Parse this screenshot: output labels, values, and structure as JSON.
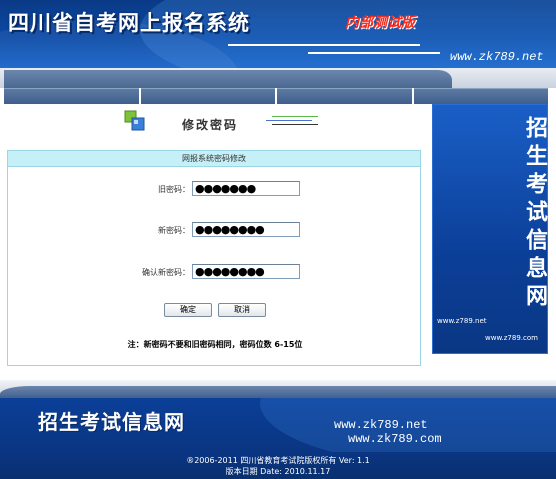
{
  "header": {
    "title": "四川省自考网上报名系统",
    "badge": "内部测试版",
    "url": "www.zk789.net"
  },
  "page": {
    "title": "修改密码"
  },
  "form": {
    "caption": "网报系统密码修改",
    "old_password_label": "旧密码：",
    "old_password_value": "●●●●●●●",
    "new_password_label": "新密码：",
    "new_password_value": "●●●●●●●●",
    "confirm_password_label": "确认新密码：",
    "confirm_password_value": "●●●●●●●●",
    "confirm_button": "确定",
    "cancel_button": "取消",
    "note": "注：新密码不要和旧密码相同，密码位数 6-15位"
  },
  "side_banner": {
    "title": "招生考试信息网",
    "url1": "www.z789.net",
    "url2": "www.z789.com"
  },
  "footer": {
    "site_name": "招生考试信息网",
    "url1": "www.zk789.net",
    "url2": "www.zk789.com",
    "copyright": "®2006-2011 四川省教育考试院版权所有  Ver: 1.1",
    "release_date": "版本日期 Date: 2010.11.17"
  },
  "colors": {
    "header_blue": "#0b4aa6",
    "badge_red": "#ff2a1a",
    "caption_cyan": "#c6f0f7"
  }
}
